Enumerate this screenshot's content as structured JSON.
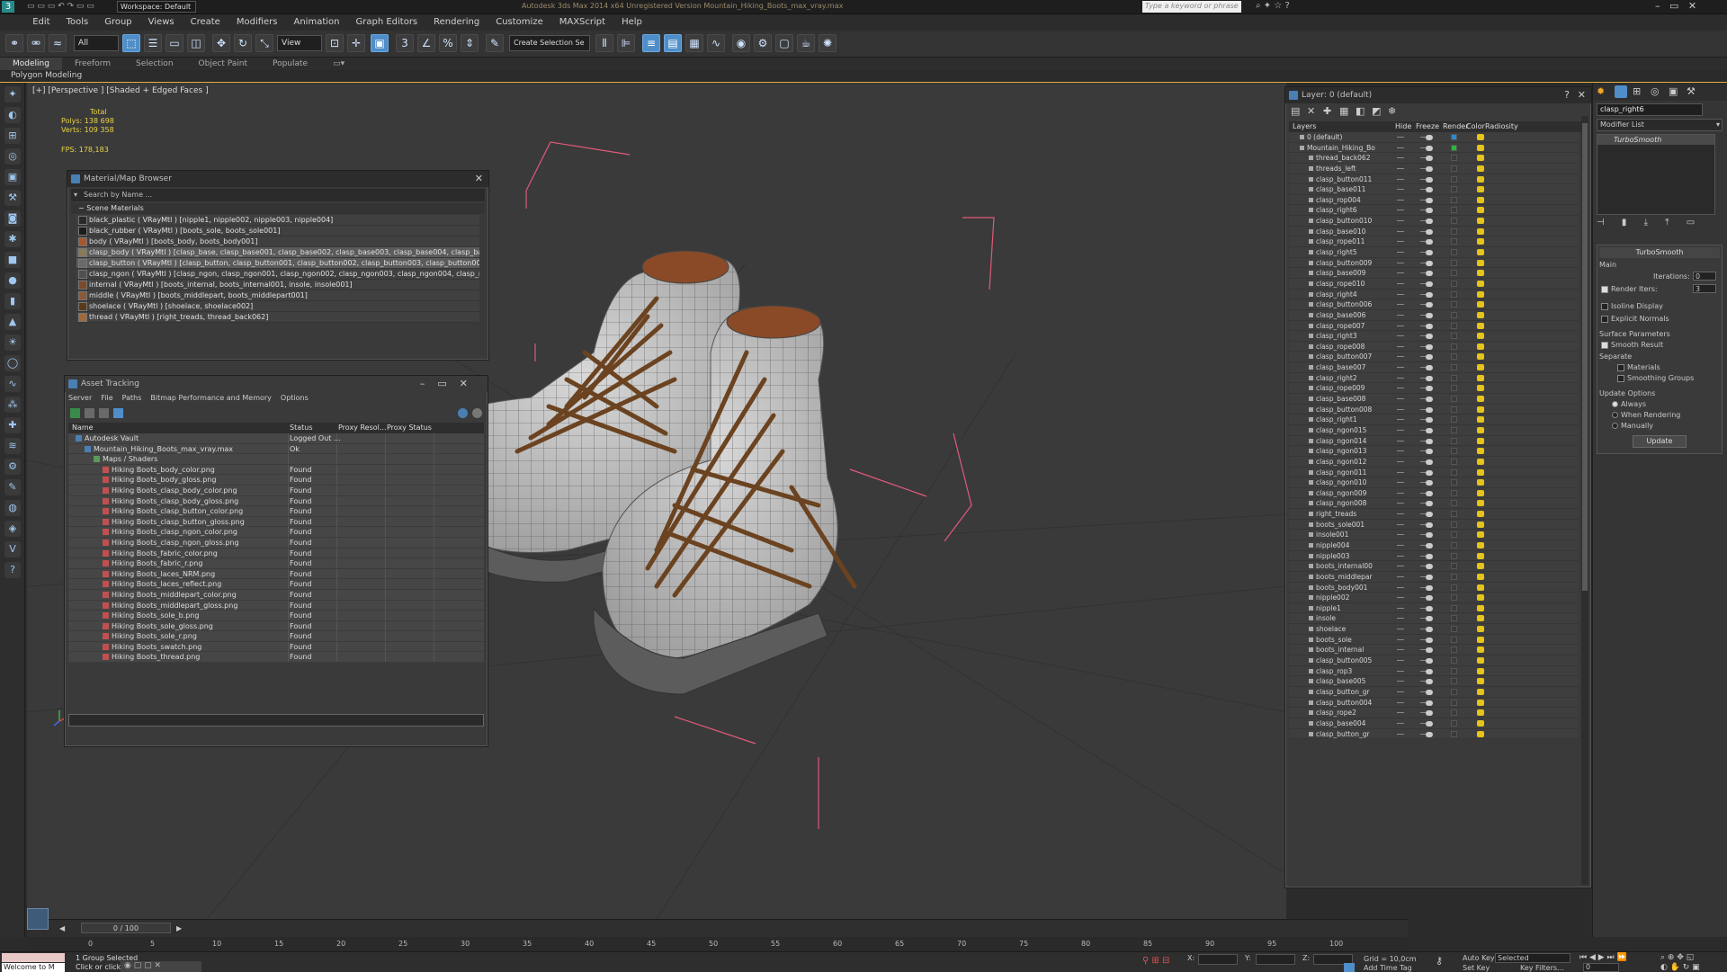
{
  "titlebar": {
    "workspace": "Workspace: Default",
    "title": "Autodesk 3ds Max  2014 x64    Unregistered Version    Mountain_Hiking_Boots_max_vray.max",
    "search_placeholder": "Type a keyword or phrase"
  },
  "menu": [
    "Edit",
    "Tools",
    "Group",
    "Views",
    "Create",
    "Modifiers",
    "Animation",
    "Graph Editors",
    "Rendering",
    "Customize",
    "MAXScript",
    "Help"
  ],
  "toolbar": {
    "filter": "All",
    "ref_coord": "View",
    "selection_set": "Create Selection Se"
  },
  "ribbon": {
    "tabs": [
      "Modeling",
      "Freeform",
      "Selection",
      "Object Paint",
      "Populate"
    ],
    "sub": "Polygon Modeling"
  },
  "viewport": {
    "label": "[+] [Perspective ] [Shaded + Edged Faces ]",
    "stats_total": "Total",
    "polys": "Polys:   138 698",
    "verts": "Verts:   109 358",
    "fps": "FPS:       178,183"
  },
  "material_browser": {
    "title": "Material/Map Browser",
    "search_placeholder": "Search by Name ...",
    "section": "Scene Materials",
    "materials": [
      {
        "text": "black_plastic  ( VRayMtl ) [nipple1, nipple002, nipple003, nipple004]",
        "color": "#2a2a2a"
      },
      {
        "text": "black_rubber  ( VRayMtl ) [boots_sole, boots_sole001]",
        "color": "#1d1d1d"
      },
      {
        "text": "body  ( VRayMtl ) [boots_body, boots_body001]",
        "color": "#a5582f"
      },
      {
        "text": "clasp_body  ( VRayMtl ) [clasp_base, clasp_base001, clasp_base002, clasp_base003, clasp_base004, clasp_bas...",
        "color": "#8a7a5a"
      },
      {
        "text": "clasp_button  ( VRayMtl ) [clasp_button, clasp_button001, clasp_button002, clasp_button003, clasp_button004...",
        "color": "#6a6a6a"
      },
      {
        "text": "clasp_ngon  ( VRayMtl ) [clasp_ngon, clasp_ngon001, clasp_ngon002, clasp_ngon003, clasp_ngon004, clasp_n...",
        "color": "#505050"
      },
      {
        "text": "internal  ( VRayMtl ) [boots_internal, boots_internal001, insole, insole001]",
        "color": "#7a4a2a"
      },
      {
        "text": "middle  ( VRayMtl ) [boots_middlepart, boots_middlepart001]",
        "color": "#8a5a3a"
      },
      {
        "text": "shoelace  ( VRayMtl ) [shoelace, shoelace002]",
        "color": "#5a3a1a"
      },
      {
        "text": "thread  ( VRayMtl ) [right_treads, thread_back062]",
        "color": "#a06a3a"
      }
    ]
  },
  "asset_tracking": {
    "title": "Asset Tracking",
    "menu": [
      "Server",
      "File",
      "Paths",
      "Bitmap Performance and Memory",
      "Options"
    ],
    "columns": [
      "Name",
      "Status",
      "Proxy Resol...",
      "Proxy Status"
    ],
    "rows": [
      {
        "name": "Autodesk Vault",
        "status": "Logged Out ...",
        "indent": 1
      },
      {
        "name": "Mountain_Hiking_Boots_max_vray.max",
        "status": "Ok",
        "indent": 2
      },
      {
        "name": "Maps / Shaders",
        "status": "",
        "indent": 3
      },
      {
        "name": "Hiking Boots_body_color.png",
        "status": "Found",
        "indent": 4
      },
      {
        "name": "Hiking Boots_body_gloss.png",
        "status": "Found",
        "indent": 4
      },
      {
        "name": "Hiking Boots_clasp_body_color.png",
        "status": "Found",
        "indent": 4
      },
      {
        "name": "Hiking Boots_clasp_body_gloss.png",
        "status": "Found",
        "indent": 4
      },
      {
        "name": "Hiking Boots_clasp_button_color.png",
        "status": "Found",
        "indent": 4
      },
      {
        "name": "Hiking Boots_clasp_button_gloss.png",
        "status": "Found",
        "indent": 4
      },
      {
        "name": "Hiking Boots_clasp_ngon_color.png",
        "status": "Found",
        "indent": 4
      },
      {
        "name": "Hiking Boots_clasp_ngon_gloss.png",
        "status": "Found",
        "indent": 4
      },
      {
        "name": "Hiking Boots_fabric_color.png",
        "status": "Found",
        "indent": 4
      },
      {
        "name": "Hiking Boots_fabric_r.png",
        "status": "Found",
        "indent": 4
      },
      {
        "name": "Hiking Boots_laces_NRM.png",
        "status": "Found",
        "indent": 4
      },
      {
        "name": "Hiking Boots_laces_reflect.png",
        "status": "Found",
        "indent": 4
      },
      {
        "name": "Hiking Boots_middlepart_color.png",
        "status": "Found",
        "indent": 4
      },
      {
        "name": "Hiking Boots_middlepart_gloss.png",
        "status": "Found",
        "indent": 4
      },
      {
        "name": "Hiking Boots_sole_b.png",
        "status": "Found",
        "indent": 4
      },
      {
        "name": "Hiking Boots_sole_gloss.png",
        "status": "Found",
        "indent": 4
      },
      {
        "name": "Hiking Boots_sole_r.png",
        "status": "Found",
        "indent": 4
      },
      {
        "name": "Hiking Boots_swatch.png",
        "status": "Found",
        "indent": 4
      },
      {
        "name": "Hiking Boots_thread.png",
        "status": "Found",
        "indent": 4
      }
    ]
  },
  "layer_explorer": {
    "title": "Layer: 0 (default)",
    "columns": [
      "Layers",
      "Hide",
      "Freeze",
      "Render",
      "Color",
      "Radiosity"
    ],
    "layers": [
      "0 (default)",
      "Mountain_Hiking_Bo",
      "thread_back062",
      "threads_left",
      "clasp_button011",
      "clasp_base011",
      "clasp_rop004",
      "clasp_right6",
      "clasp_button010",
      "clasp_base010",
      "clasp_rope011",
      "clasp_right5",
      "clasp_button009",
      "clasp_base009",
      "clasp_rope010",
      "clasp_right4",
      "clasp_button006",
      "clasp_base006",
      "clasp_rope007",
      "clasp_right3",
      "clasp_rope008",
      "clasp_button007",
      "clasp_base007",
      "clasp_right2",
      "clasp_rope009",
      "clasp_base008",
      "clasp_button008",
      "clasp_right1",
      "clasp_ngon015",
      "clasp_ngon014",
      "clasp_ngon013",
      "clasp_ngon012",
      "clasp_ngon011",
      "clasp_ngon010",
      "clasp_ngon009",
      "clasp_ngon008",
      "right_treads",
      "boots_sole001",
      "insole001",
      "nipple004",
      "nipple003",
      "boots_internal00",
      "boots_middlepar",
      "boots_body001",
      "nipple002",
      "nipple1",
      "insole",
      "shoelace",
      "boots_sole",
      "boots_internal",
      "clasp_button005",
      "clasp_rop3",
      "clasp_base005",
      "clasp_button_gr",
      "clasp_button004",
      "clasp_rope2",
      "clasp_base004",
      "clasp_button_gr"
    ]
  },
  "command_panel": {
    "object_name": "clasp_right6",
    "modifier_list": "Modifier List",
    "modifier": "TurboSmooth",
    "rollout": "TurboSmooth",
    "main": "Main",
    "iterations_label": "Iterations:",
    "iterations": "0",
    "render_iters_label": "Render Iters:",
    "render_iters": "3",
    "isoline": "Isoline Display",
    "explicit": "Explicit Normals",
    "surface": "Surface Parameters",
    "smooth_result": "Smooth Result",
    "separate": "Separate",
    "materials": "Materials",
    "smoothing_groups": "Smoothing Groups",
    "update_options": "Update Options",
    "always": "Always",
    "when_rendering": "When Rendering",
    "manually": "Manually",
    "update_button": "Update"
  },
  "timeline": {
    "frame": "0 / 100",
    "ticks": [
      "0",
      "5",
      "10",
      "15",
      "20",
      "25",
      "30",
      "35",
      "40",
      "45",
      "50",
      "55",
      "60",
      "65",
      "70",
      "75",
      "80",
      "85",
      "90",
      "95",
      "100"
    ]
  },
  "status": {
    "maxscript": "Welcome to M",
    "selected": "1 Group Selected",
    "prompt": "Click or click",
    "x_label": "X:",
    "y_label": "Y:",
    "z_label": "Z:",
    "grid": "Grid = 10,0cm",
    "auto_key": "Auto Key",
    "selected_combo": "Selected",
    "set_key": "Set Key",
    "key_filters": "Key Filters...",
    "add_time_tag": "Add Time Tag",
    "frame_field": "0"
  },
  "colors": {
    "accent": "#4f8ec9",
    "status_found": "#dddddd",
    "radiosity": "#e6c41a",
    "viewport_bg": "#3a3a3a"
  }
}
